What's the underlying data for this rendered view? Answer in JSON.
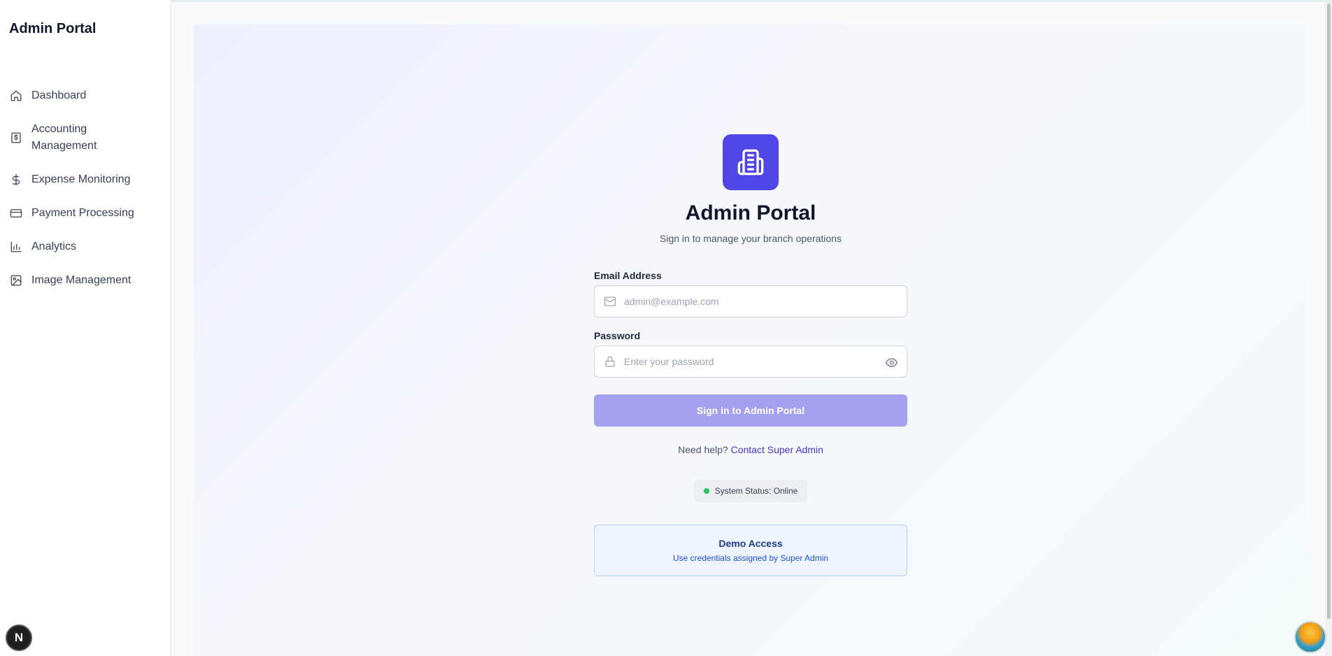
{
  "sidebar": {
    "brand": "Admin Portal",
    "items": [
      {
        "label": "Dashboard",
        "icon": "home-icon"
      },
      {
        "label": "Accounting\nManagement",
        "line1": "Accounting",
        "line2": "Management",
        "icon": "receipt-icon"
      },
      {
        "label": "Expense Monitoring",
        "icon": "dollar-icon"
      },
      {
        "label": "Payment Processing",
        "icon": "credit-card-icon"
      },
      {
        "label": "Analytics",
        "icon": "bar-chart-icon"
      },
      {
        "label": "Image Management",
        "icon": "image-icon"
      }
    ]
  },
  "login": {
    "title": "Admin Portal",
    "subtitle": "Sign in to manage your branch operations",
    "email_label": "Email Address",
    "email_placeholder": "admin@example.com",
    "email_value": "",
    "password_label": "Password",
    "password_placeholder": "Enter your password",
    "password_value": "",
    "submit_label": "Sign in to Admin Portal",
    "help_text": "Need help?",
    "help_link": "Contact Super Admin",
    "status_text": "System Status: Online",
    "demo_title": "Demo Access",
    "demo_desc": "Use credentials assigned by Super Admin"
  },
  "badges": {
    "next_badge": "N"
  },
  "colors": {
    "accent": "#4f46e5",
    "button_disabled": "#a5a1f0",
    "link": "#4338ca",
    "status_online": "#22c55e",
    "demo_bg": "#eff5ff",
    "demo_border": "#bcd2f5"
  }
}
